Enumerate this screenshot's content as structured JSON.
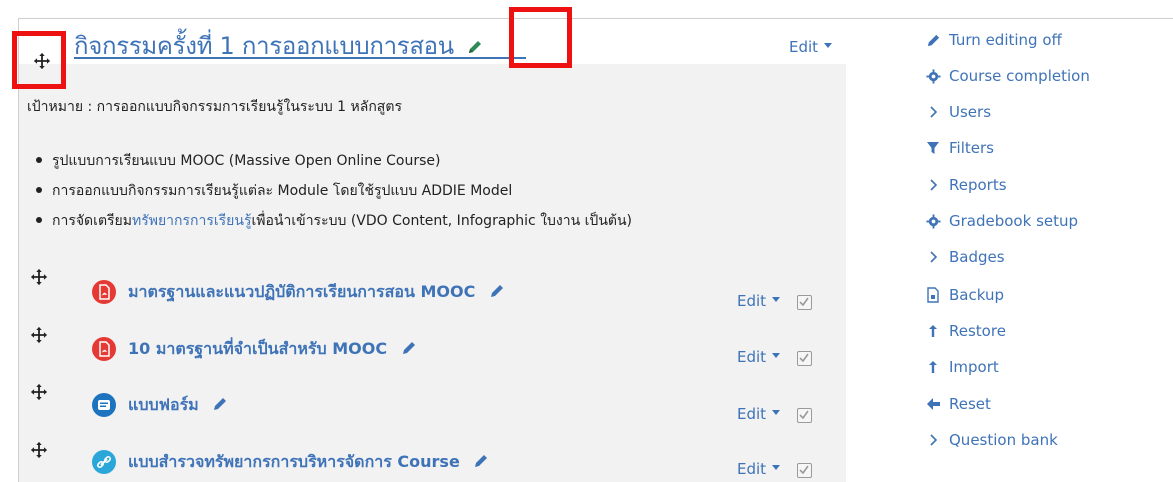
{
  "section": {
    "title": "กิจกรรมครั้งที่ 1 การออกแบบการสอน",
    "edit_label": "Edit",
    "goal": "เป้าหมาย : การออกแบบกิจกรรมการเรียนรู้ในระบบ 1 หลักสูตร",
    "bullets": [
      {
        "text": "รูปแบบการเรียนแบบ MOOC (Massive Open Online Course)"
      },
      {
        "text": "การออกแบบกิจกรรมการเรียนรู้แต่ละ Module โดยใช้รูปแบบ ADDIE Model"
      },
      {
        "before": "การจัดเตรียม",
        "link": "ทรัพยากรการเรียนรู้",
        "after": "เพื่อนำเข้าระบบ (VDO Content, Infographic ใบงาน เป็นต้น)"
      }
    ]
  },
  "activities": [
    {
      "title": "มาตรฐานและแนวปฏิบัติการเรียนการสอน MOOC",
      "icon": "pdf-icon",
      "edit_label": "Edit"
    },
    {
      "title": "10 มาตรฐานที่จำเป็นสำหรับ MOOC",
      "icon": "pdf-icon",
      "edit_label": "Edit"
    },
    {
      "title": "แบบฟอร์ม",
      "icon": "forum-icon",
      "edit_label": "Edit"
    },
    {
      "title": "แบบสำรวจทรัพยากรการบริหารจัดการ Course",
      "icon": "url-link-icon",
      "edit_label": "Edit"
    }
  ],
  "admin_menu": [
    {
      "label": "Turn editing off",
      "icon": "pencil-icon"
    },
    {
      "label": "Course completion",
      "icon": "gear-icon"
    },
    {
      "label": "Users",
      "icon": "chevron-right-icon"
    },
    {
      "label": "Filters",
      "icon": "filter-icon"
    },
    {
      "label": "Reports",
      "icon": "chevron-right-icon"
    },
    {
      "label": "Gradebook setup",
      "icon": "gear-icon"
    },
    {
      "label": "Badges",
      "icon": "chevron-right-icon"
    },
    {
      "label": "Backup",
      "icon": "file-icon"
    },
    {
      "label": "Restore",
      "icon": "upload-arrow-icon"
    },
    {
      "label": "Import",
      "icon": "upload-arrow-icon"
    },
    {
      "label": "Reset",
      "icon": "arrow-left-icon"
    },
    {
      "label": "Question bank",
      "icon": "chevron-right-icon"
    }
  ],
  "colors": {
    "link": "#3f73b8",
    "highlight": "#ee1111",
    "pdf": "#e53935",
    "forum": "#1e73be",
    "url": "#2ba6d9"
  }
}
